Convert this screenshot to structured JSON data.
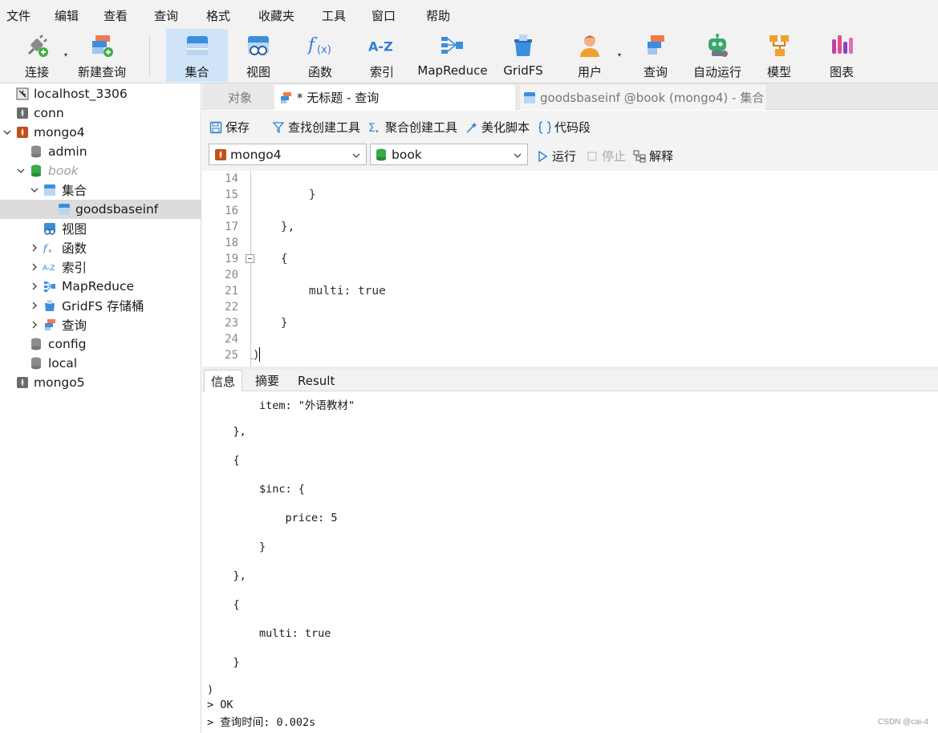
{
  "menu": [
    "文件",
    "编辑",
    "查看",
    "查询",
    "格式",
    "收藏夹",
    "工具",
    "窗口",
    "帮助"
  ],
  "toolbar": {
    "connect": "连接",
    "new_query": "新建查询",
    "collection": "集合",
    "view": "视图",
    "function": "函数",
    "index": "索引",
    "mapreduce": "MapReduce",
    "gridfs": "GridFS",
    "user": "用户",
    "query": "查询",
    "automation": "自动运行",
    "model": "模型",
    "chart": "图表",
    "accent": "#cfe4f7"
  },
  "sidebar": {
    "items": [
      {
        "label": "localhost_3306",
        "icon": "server-icon"
      },
      {
        "label": "conn",
        "icon": "mongo-leaf-icon"
      },
      {
        "label": "mongo4",
        "icon": "mongo-leaf-icon"
      },
      {
        "label": "admin",
        "icon": "database-icon"
      },
      {
        "label": "book",
        "icon": "database-icon"
      },
      {
        "label": "集合",
        "icon": "collection-icon"
      },
      {
        "label": "goodsbaseinf",
        "icon": "table-icon"
      },
      {
        "label": "视图",
        "icon": "view-icon"
      },
      {
        "label": "函数",
        "icon": "function-icon"
      },
      {
        "label": "索引",
        "icon": "index-icon"
      },
      {
        "label": "MapReduce",
        "icon": "mapreduce-icon"
      },
      {
        "label": "GridFS 存储桶",
        "icon": "gridfs-icon"
      },
      {
        "label": "查询",
        "icon": "query-icon"
      },
      {
        "label": "config",
        "icon": "database-icon"
      },
      {
        "label": "local",
        "icon": "database-icon"
      },
      {
        "label": "mongo5",
        "icon": "mongo-leaf-icon"
      }
    ]
  },
  "tabs": {
    "objects": "对象",
    "active": "* 无标题 - 查询",
    "other": "goodsbaseinf @book (mongo4) - 集合"
  },
  "editor_toolbar": {
    "save": "保存",
    "find_builder": "查找创建工具",
    "aggregate_builder": "聚合创建工具",
    "beautify": "美化脚本",
    "snippet": "代码段",
    "connection": "mongo4",
    "database": "book",
    "run": "运行",
    "stop": "停止",
    "explain": "解释"
  },
  "editor": {
    "lines": [
      {
        "n": "14",
        "text": ""
      },
      {
        "n": "15",
        "text": "        }"
      },
      {
        "n": "16",
        "text": ""
      },
      {
        "n": "17",
        "text": "    },"
      },
      {
        "n": "18",
        "text": ""
      },
      {
        "n": "19",
        "text": "    {"
      },
      {
        "n": "20",
        "text": ""
      },
      {
        "n": "21",
        "text": "        multi: true"
      },
      {
        "n": "22",
        "text": ""
      },
      {
        "n": "23",
        "text": "    }"
      },
      {
        "n": "24",
        "text": ""
      },
      {
        "n": "25",
        "text": ")"
      }
    ]
  },
  "result_tabs": [
    "信息",
    "摘要",
    "Result"
  ],
  "output": {
    "lines": [
      "        item: \"外语教材\"",
      "",
      "    },",
      "",
      "    {",
      "",
      "        $inc: {",
      "",
      "            price: 5",
      "",
      "        }",
      "",
      "    },",
      "",
      "    {",
      "",
      "        multi: true",
      "",
      "    }",
      "",
      ")",
      "> OK",
      "> 查询时间: 0.002s"
    ]
  },
  "watermark": "CSDN @cai-4"
}
